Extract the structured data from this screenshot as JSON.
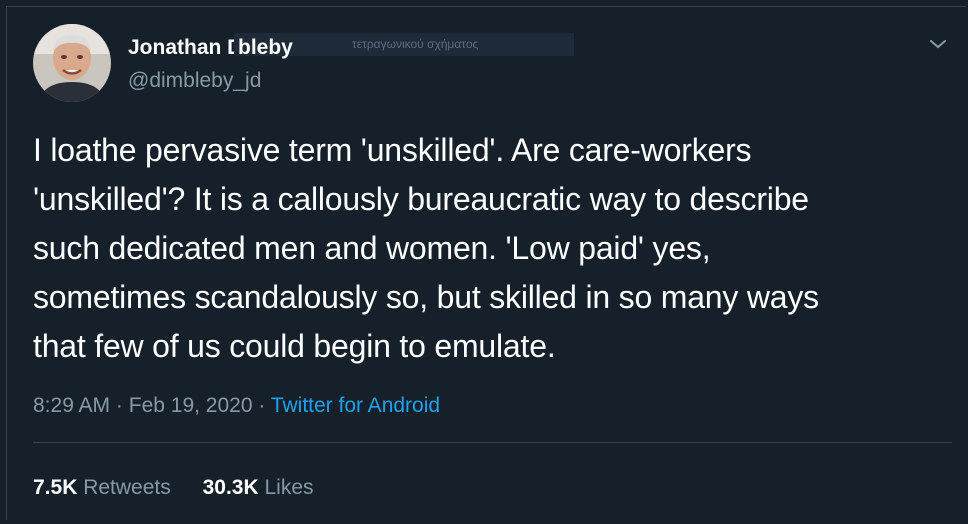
{
  "author": {
    "name": "Jonathan Dimbleby",
    "name_first": "Jonathan Dim",
    "name_rest": "bleby",
    "handle": "@dimbleby_jd",
    "overlay_text": "τετραγωνικού σχήματος"
  },
  "tweet": {
    "lines": [
      "I loathe pervasive term 'unskilled'. Are care-workers",
      "'unskilled'? It is a callously bureaucratic  way to describe",
      "such dedicated men and women. 'Low paid' yes,",
      "sometimes scandalously so, but skilled in so many ways",
      "that few of us could begin to emulate."
    ]
  },
  "meta": {
    "time": "8:29 AM",
    "separator1": "·",
    "date": "Feb 19, 2020",
    "separator2": "·",
    "source": "Twitter for Android"
  },
  "stats": {
    "retweets_count": "7.5K",
    "retweets_label": "Retweets",
    "likes_count": "30.3K",
    "likes_label": "Likes"
  },
  "colors": {
    "background": "#15202b",
    "secondary_text": "#8899a6",
    "link": "#1da1f2",
    "divider": "#38444d"
  },
  "icons": {
    "chevron": "chevron-down-icon",
    "avatar": "avatar"
  }
}
